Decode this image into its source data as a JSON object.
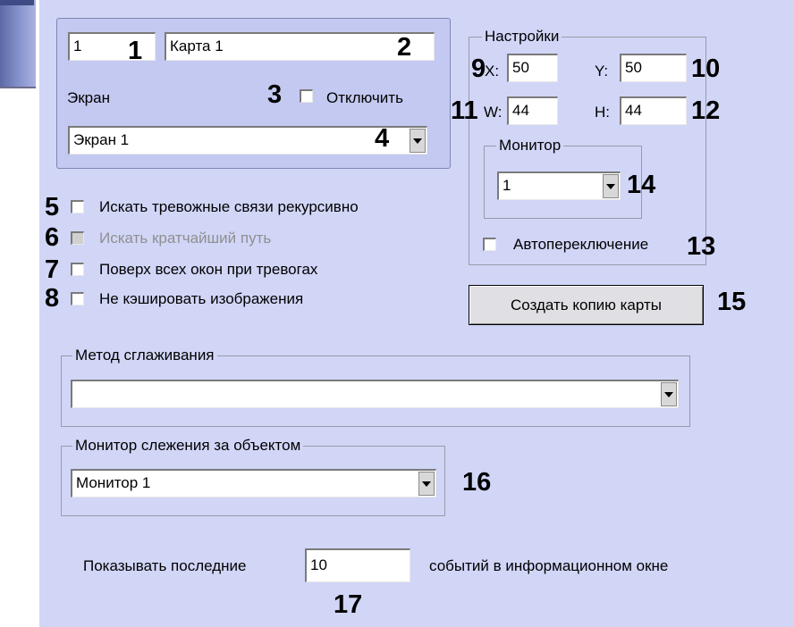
{
  "map": {
    "id_value": "1",
    "name_value": "Карта 1",
    "screen_label": "Экран",
    "disable_label": "Отключить",
    "screen_select": "Экран 1"
  },
  "options": {
    "recursive_label": "Искать тревожные связи рекурсивно",
    "shortest_label": "Искать кратчайший путь",
    "on_top_label": "Поверх всех окон при тревогах",
    "no_cache_label": "Не кэшировать изображения"
  },
  "settings": {
    "legend": "Настройки",
    "x_label": "X:",
    "x_value": "50",
    "y_label": "Y:",
    "y_value": "50",
    "w_label": "W:",
    "w_value": "44",
    "h_label": "H:",
    "h_value": "44",
    "monitor_legend": "Монитор",
    "monitor_value": "1",
    "autoswitch_label": "Автопереключение"
  },
  "copy_button": "Создать копию карты",
  "smoothing": {
    "legend": "Метод сглаживания",
    "value": ""
  },
  "tracking": {
    "legend": "Монитор слежения за объектом",
    "value": "Монитор 1"
  },
  "events": {
    "prefix": "Показывать последние",
    "count": "10",
    "suffix": "событий в информационном окне"
  },
  "callouts": [
    "1",
    "2",
    "3",
    "4",
    "5",
    "6",
    "7",
    "8",
    "9",
    "10",
    "11",
    "12",
    "13",
    "14",
    "15",
    "16",
    "17"
  ]
}
